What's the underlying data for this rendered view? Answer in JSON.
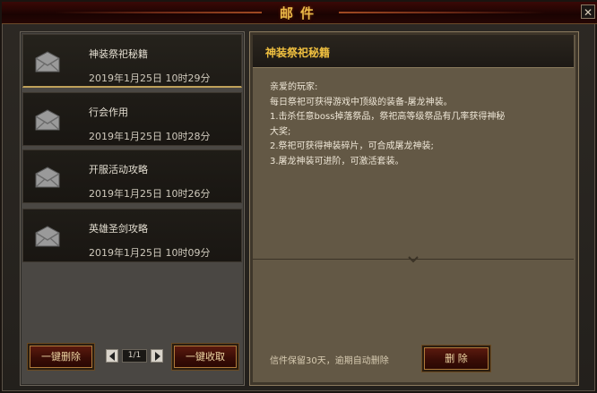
{
  "window": {
    "title": "邮件",
    "close_symbol": "✕"
  },
  "mail_list": {
    "items": [
      {
        "subject": "神装祭祀秘籍",
        "date": "2019年1月25日 10时29分",
        "selected": true
      },
      {
        "subject": "行会作用",
        "date": "2019年1月25日 10时28分",
        "selected": false
      },
      {
        "subject": "开服活动攻略",
        "date": "2019年1月25日 10时26分",
        "selected": false
      },
      {
        "subject": "英雄圣剑攻略",
        "date": "2019年1月25日 10时09分",
        "selected": false
      }
    ],
    "icon": "envelope-icon"
  },
  "toolbar": {
    "delete_all_label": "一键删除",
    "collect_all_label": "一键收取",
    "page_indicator": "1/1"
  },
  "letter": {
    "title": "神装祭祀秘籍",
    "lines": [
      "亲爱的玩家:",
      "每日祭祀可获得游戏中顶级的装备-屠龙神装。",
      "1.击杀任意boss掉落祭品，祭祀高等级祭品有几率获得神秘",
      "大奖;",
      "2.祭祀可获得神装碎片，可合成屠龙神装;",
      "3.屠龙神装可进阶，可激活套装。"
    ],
    "retention_note": "信件保留30天，逾期自动删除",
    "delete_label": "删 除"
  },
  "colors": {
    "title_gold": "#e9b949",
    "letter_title": "#f0c040",
    "button_red": "#3a0d06"
  }
}
